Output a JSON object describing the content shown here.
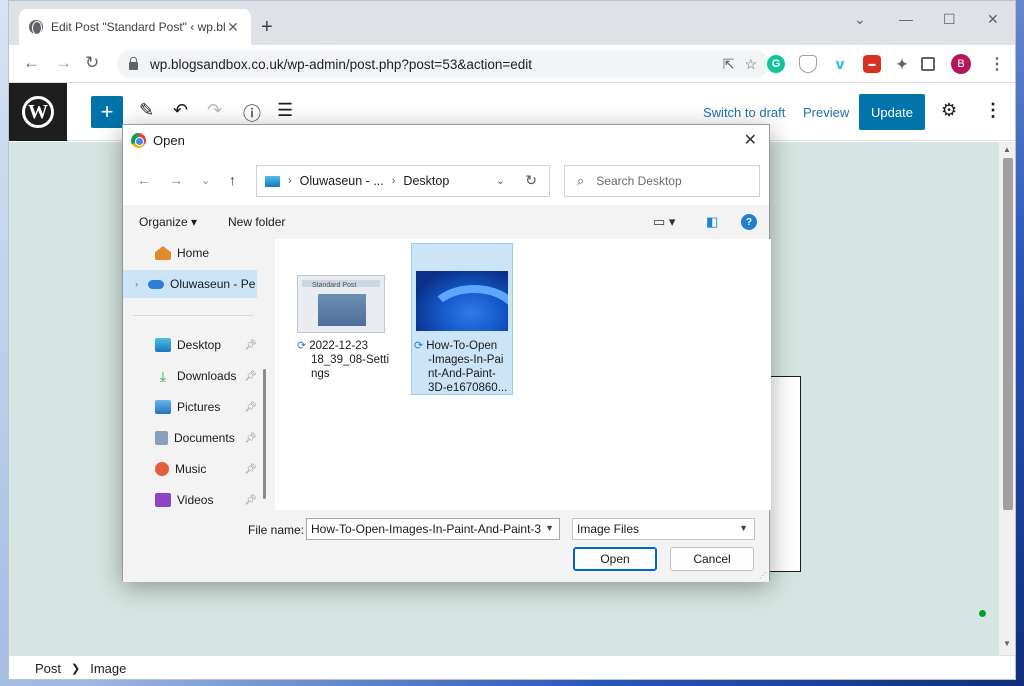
{
  "browser": {
    "tab_title": "Edit Post \"Standard Post\" ‹ wp.bl",
    "url": "wp.blogsandbox.co.uk/wp-admin/post.php?post=53&action=edit",
    "profile_initial": "B"
  },
  "wp": {
    "switch_to_draft": "Switch to draft",
    "preview": "Preview",
    "update": "Update",
    "breadcrumb": [
      "Post",
      "Image"
    ]
  },
  "dialog": {
    "title": "Open",
    "address": [
      "Oluwaseun - ...",
      "Desktop"
    ],
    "search_placeholder": "Search Desktop",
    "organize": "Organize",
    "new_folder": "New folder",
    "nav_items": [
      {
        "label": "Home",
        "icon": "home-icon",
        "pinned": false
      },
      {
        "label": "Oluwaseun - Pe",
        "icon": "cloud-icon",
        "pinned": false,
        "selected": true
      },
      {
        "label": "Desktop",
        "icon": "desktop-icon",
        "pinned": true
      },
      {
        "label": "Downloads",
        "icon": "download-icon",
        "pinned": true
      },
      {
        "label": "Pictures",
        "icon": "pictures-icon",
        "pinned": true
      },
      {
        "label": "Documents",
        "icon": "documents-icon",
        "pinned": true
      },
      {
        "label": "Music",
        "icon": "music-icon",
        "pinned": true
      },
      {
        "label": "Videos",
        "icon": "videos-icon",
        "pinned": true
      }
    ],
    "files": [
      {
        "name_lines": [
          "2022-12-23",
          "18_39_08-Setti",
          "ngs"
        ],
        "thumb_title": "Standard Post",
        "selected": false
      },
      {
        "name_lines": [
          "How-To-Open",
          "-Images-In-Pai",
          "nt-And-Paint-",
          "3D-e1670860..."
        ],
        "selected": true
      }
    ],
    "file_name_label": "File name:",
    "file_name_value": "How-To-Open-Images-In-Paint-And-Paint-3",
    "file_type": "Image Files",
    "open_button": "Open",
    "cancel_button": "Cancel"
  },
  "colors": {
    "wp_blue": "#0073aa",
    "selection": "#cce4f7",
    "canvas": "#d6e5e1"
  }
}
